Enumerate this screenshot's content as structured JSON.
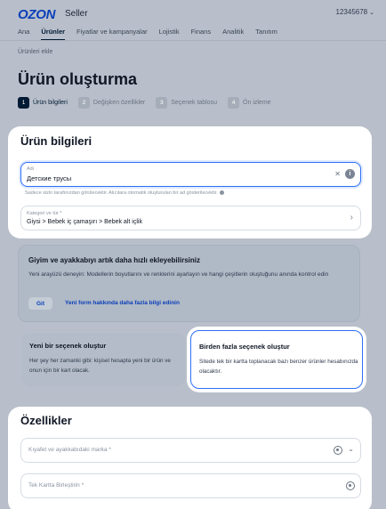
{
  "header": {
    "brand": "OZON",
    "brand_sub": "Seller",
    "account_id": "12345678"
  },
  "nav": {
    "tabs": [
      {
        "label": "Ana",
        "active": false
      },
      {
        "label": "Ürünler",
        "active": true
      },
      {
        "label": "Fiyatlar ve kampanyalar",
        "active": false
      },
      {
        "label": "Lojistik",
        "active": false
      },
      {
        "label": "Finans",
        "active": false
      },
      {
        "label": "Analitik",
        "active": false
      },
      {
        "label": "Tanıtım",
        "active": false
      }
    ]
  },
  "breadcrumb": "Ürünleri ekle",
  "page_title": "Ürün oluşturma",
  "steps": [
    {
      "num": "1",
      "label": "Ürün bilgileri",
      "active": true
    },
    {
      "num": "2",
      "label": "Değişken özellikler",
      "active": false
    },
    {
      "num": "3",
      "label": "Seçenek tablosu",
      "active": false
    },
    {
      "num": "4",
      "label": "Ön izleme",
      "active": false
    }
  ],
  "product_info": {
    "title": "Ürün bilgileri",
    "name_label": "Adı",
    "name_value": "Детские трусы",
    "name_hint": "Sadece sizin tarafınızdan görülecektir. Alıcılara otomatik oluşturulan bir ad gösterilecektir.",
    "category_label": "Kategori ve tür *",
    "category_value": "Giysi > Bebek iç çamaşırı > Bebek alt içlik"
  },
  "shoe_banner": {
    "title": "Giyim ve ayakkabıyı artık daha hızlı ekleyebilirsiniz",
    "text": "Yeni arayüzü deneyin: Modellerin boyutlarını ve renklerini ayarlayın ve hangi çeşitlerin oluştuğunu anında kontrol edin",
    "go_label": "Git",
    "learn_label": "Yeni form hakkında daha fazla bilgi edinin"
  },
  "options": {
    "single_title": "Yeni bir seçenek oluştur",
    "single_text": "Her şey her zamanki gibi: kişisel hesapta yeni bir ürün ve onun için bir kart olacak.",
    "multi_title": "Birden fazla seçenek oluştur",
    "multi_text": "Sitede tek bir kartta toplanacak bazı benzer ürünler hesabınızda olacaktır."
  },
  "properties": {
    "title": "Özellikler",
    "brand_placeholder": "Kıyafet ve ayakkabıdaki marka *",
    "merge_placeholder": "Tek Kartta Birleştirin *"
  },
  "colors": {
    "accent": "#2d6ff7",
    "brand": "#0a3fb8",
    "overlay_bg": "#b8bfca"
  }
}
